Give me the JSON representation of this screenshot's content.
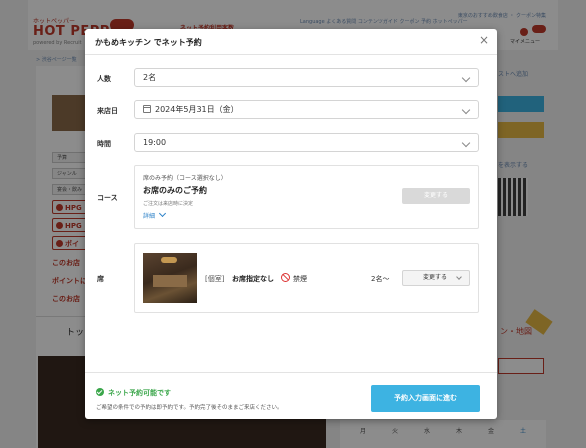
{
  "background": {
    "logo_small": "ホットペッパー",
    "logo": "HOT PEPPER",
    "logo_sub": "powered by Recruit",
    "tagline": "ネット予約利用客数",
    "nav_links": "Language  よくある質問  コンテンツガイド  クーポン 予約 ホットペッパー",
    "top_links": "東京のおすすめ飲食店 ・ クーポン特集",
    "breadcrumb": "> 渋谷ページ一覧",
    "chips": [
      "予算",
      "ジャンル",
      "宴会・飲み"
    ],
    "hpg_labels": [
      "HPG",
      "HPG"
    ],
    "point_label": "ポイ",
    "red_texts": [
      "このお店",
      "ポイントに",
      "このお店"
    ],
    "tab_label": "トッ",
    "access_label": "ン・地図",
    "my_menu": "マイメニュー",
    "right_link_1": "ストへ追加",
    "right_link_2": "を表示する",
    "calendar_days": [
      "月",
      "火",
      "水",
      "木",
      "金",
      "土"
    ]
  },
  "modal": {
    "title": "かもめキッチン でネット予約",
    "close_icon": "×",
    "people": {
      "label": "人数",
      "value": "2名"
    },
    "date": {
      "label": "来店日",
      "value": "2024年5月31日（金）"
    },
    "time": {
      "label": "時間",
      "value": "19:00"
    },
    "course": {
      "label": "コース",
      "subtitle": "席のみ予約（コース選択なし）",
      "title": "お席のみのご予約",
      "note": "ご注文は来店時に決定",
      "detail": "詳細",
      "button": "変更する"
    },
    "seat": {
      "label": "席",
      "type": "[個室]",
      "name": "お席指定なし",
      "smoking": "禁煙",
      "capacity": "2名〜",
      "button": "変更する"
    },
    "footer": {
      "status": "ネット予約可能です",
      "note": "ご希望の条件での予約は即予約です。予約完了後そのままご来店ください。",
      "submit": "予約入力画面に進む"
    }
  }
}
